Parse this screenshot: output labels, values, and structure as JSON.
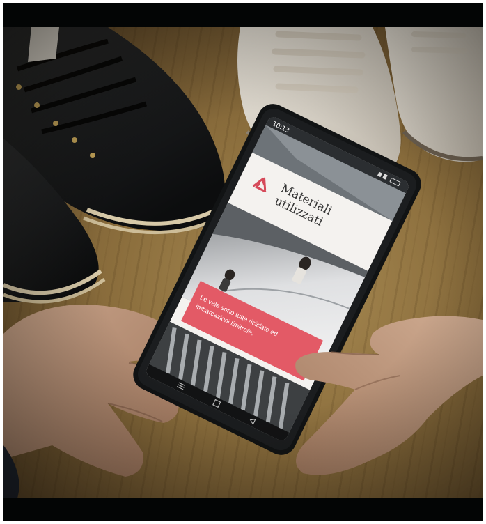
{
  "phone": {
    "status_time": "10:13",
    "heading_line1": "Materiali",
    "heading_line2": "utilizzati",
    "banner_line1": "Le vele sono tutte riciclate ed",
    "banner_line2": "imbarcazioni limitrofe."
  },
  "icons": {
    "recycle": "recycle-icon",
    "nav_menu": "menu-icon",
    "nav_home": "home-icon",
    "nav_back": "back-icon"
  },
  "colors": {
    "letterbox": "#030505",
    "wood": "#8a6d3c",
    "banner_red": "#e35a66",
    "recycle_red": "#d64a5a",
    "screen_bg": "#f4f2ef"
  }
}
